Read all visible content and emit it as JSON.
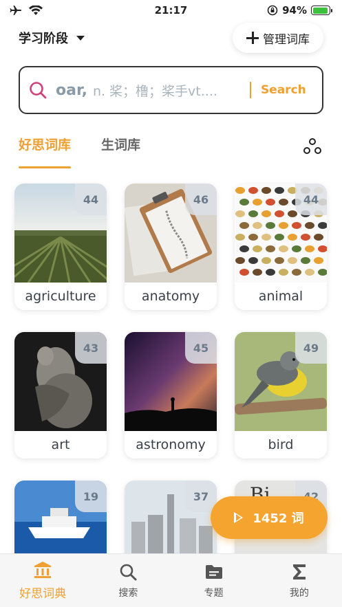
{
  "status": {
    "time": "21:17",
    "battery": "94%",
    "battery_level": 0.94
  },
  "header": {
    "stage_label": "学习阶段",
    "manage_label": "管理词库"
  },
  "search": {
    "query": "oar,",
    "hint": "n. 桨；橹；桨手vt....",
    "action": "Search"
  },
  "tabs": [
    {
      "label": "好思词库"
    },
    {
      "label": "生词库"
    }
  ],
  "cards": [
    {
      "label": "agriculture",
      "count": "44"
    },
    {
      "label": "anatomy",
      "count": "46"
    },
    {
      "label": "animal",
      "count": "44"
    },
    {
      "label": "art",
      "count": "43"
    },
    {
      "label": "astronomy",
      "count": "45"
    },
    {
      "label": "bird",
      "count": "49"
    },
    {
      "label": "",
      "count": "19"
    },
    {
      "label": "",
      "count": "37"
    },
    {
      "label": "",
      "count": "42"
    }
  ],
  "play": {
    "label": "1452 词"
  },
  "nav": [
    {
      "label": "好思词典",
      "icon": "library-icon"
    },
    {
      "label": "搜索",
      "icon": "search-icon"
    },
    {
      "label": "专题",
      "icon": "folder-icon"
    },
    {
      "label": "我的",
      "icon": "sigma-icon"
    }
  ],
  "colors": {
    "accent": "#f0a030",
    "text": "#222222",
    "muted": "#8a9aa6"
  }
}
